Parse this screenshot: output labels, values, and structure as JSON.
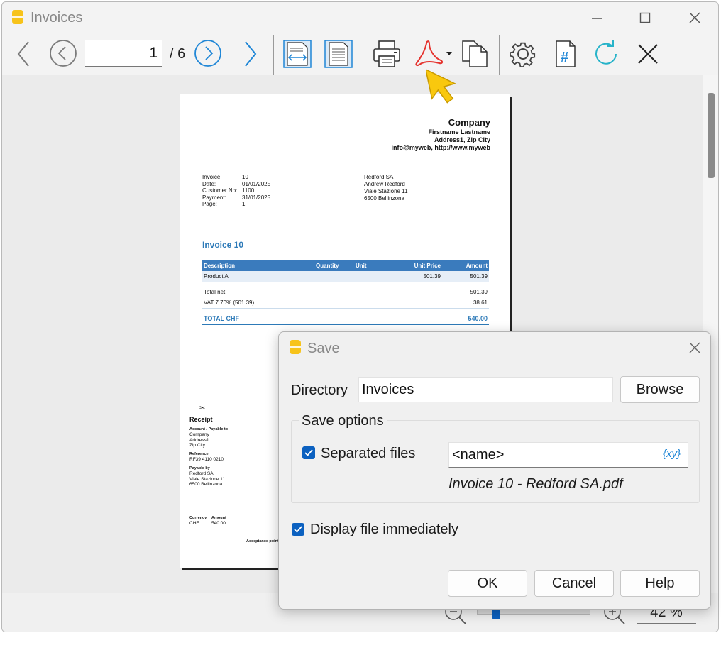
{
  "window": {
    "title": "Invoices",
    "controls": [
      "minimize",
      "maximize",
      "close"
    ]
  },
  "toolbar": {
    "page_current": "1",
    "page_total": "/ 6",
    "icons": [
      "previous-arrow",
      "previous-circle",
      "next-circle",
      "next-arrow",
      "fit-width",
      "fit-page",
      "print",
      "pdf-export",
      "copy",
      "settings",
      "page-number",
      "refresh",
      "close"
    ]
  },
  "document": {
    "company": {
      "name": "Company",
      "contact": "Firstname Lastname",
      "address": "Address1, Zip City",
      "web": "info@myweb, http://www.myweb"
    },
    "info": [
      {
        "label": "Invoice:",
        "value": "10"
      },
      {
        "label": "Date:",
        "value": "01/01/2025"
      },
      {
        "label": "Customer No:",
        "value": "1100"
      },
      {
        "label": "Payment:",
        "value": "31/01/2025"
      },
      {
        "label": "Page:",
        "value": "1"
      }
    ],
    "customer": [
      "Redford SA",
      "Andrew Redford",
      "Viale Stazione 11",
      "6500 Bellinzona"
    ],
    "heading": "Invoice 10",
    "table": {
      "headers": {
        "description": "Description",
        "quantity": "Quantity",
        "unit": "Unit",
        "unit_price": "Unit Price",
        "amount": "Amount"
      },
      "item": {
        "description": "Product A",
        "unit_price": "501.39",
        "amount": "501.39"
      },
      "total_net": {
        "label": "Total net",
        "amount": "501.39"
      },
      "vat": {
        "label": "VAT 7.70% (501.39)",
        "amount": "38.61"
      },
      "total": {
        "label": "TOTAL CHF",
        "amount": "540.00"
      }
    },
    "receipt": {
      "title": "Receipt",
      "account_label": "Account / Payable to",
      "account_lines": [
        "Company",
        "Address1",
        "Zip City"
      ],
      "reference_label": "Reference",
      "reference": "RF39 4110 0210",
      "payable_by_label": "Payable by",
      "payable_by_lines": [
        "Redford SA",
        "Viale Stazione 11",
        "6500 Bellinzona"
      ],
      "currency_label": "Currency",
      "amount_label": "Amount",
      "currency": "CHF",
      "amount": "540.00",
      "acceptance": "Acceptance point"
    }
  },
  "status": {
    "zoom_value": "42 %",
    "zoom_fraction": 0.18
  },
  "dialog": {
    "title": "Save",
    "directory_label": "Directory",
    "directory_value": "Invoices",
    "browse_label": "Browse",
    "group_label": "Save options",
    "separated_files_label": "Separated files",
    "separated_files_checked": true,
    "name_pattern": "<name>",
    "xy_label": "{xy}",
    "preview_filename": "Invoice 10 - Redford SA.pdf",
    "display_immediately_label": "Display file immediately",
    "display_immediately_checked": true,
    "ok_label": "OK",
    "cancel_label": "Cancel",
    "help_label": "Help"
  },
  "colors": {
    "accent_blue": "#0c61c0",
    "icon_blue": "#1f86d6",
    "pdf_red": "#e5322d",
    "doc_blue": "#2d7ab8",
    "app_logo_yellow": "#f7c31a",
    "cursor_yellow": "#f9c80e"
  }
}
